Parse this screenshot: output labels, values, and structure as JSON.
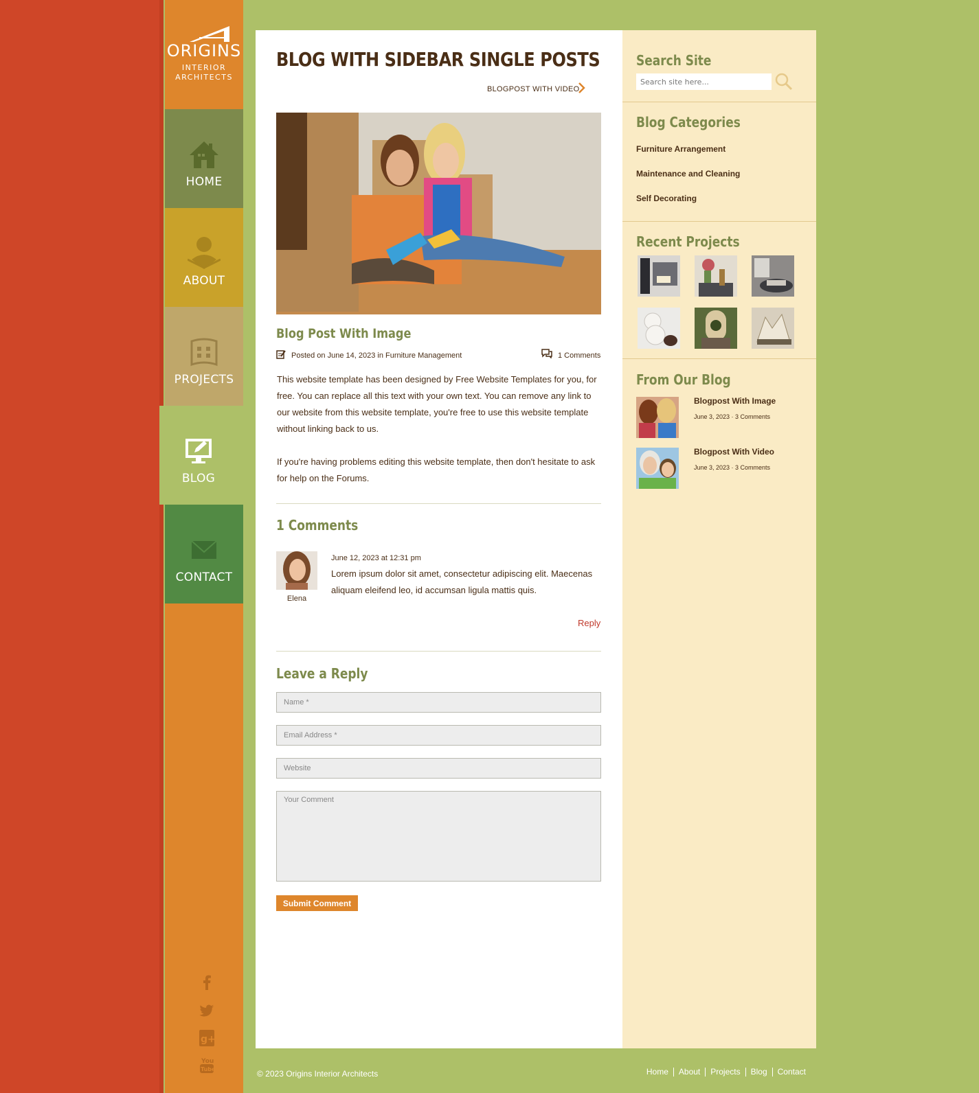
{
  "brand": {
    "name": "ORIGINS",
    "tagline_line1": "INTERIOR",
    "tagline_line2": "ARCHITECTS"
  },
  "nav": {
    "home": "HOME",
    "about": "ABOUT",
    "projects": "PROJECTS",
    "blog": "BLOG",
    "contact": "CONTACT",
    "active": "blog"
  },
  "social": [
    "facebook-icon",
    "twitter-icon",
    "google-plus-icon",
    "youtube-icon"
  ],
  "page": {
    "title": "BLOG WITH SIDEBAR SINGLE POSTS",
    "next_post_label": "BLOGPOST WITH VIDEO"
  },
  "post": {
    "title": "Blog Post With Image",
    "meta": "Posted on June 14, 2023 in Furniture Management",
    "comments_count": "1 Comments",
    "paragraph1": "This website template has been designed by Free Website Templates for you, for free. You can replace all this text with your own text. You can remove any link to our website from this website template, you're free to use this website template without linking back to us.",
    "paragraph2": "If you're having problems editing this website template, then don't hesitate to ask for help on the Forums."
  },
  "comments": {
    "heading": "1 Comments",
    "items": [
      {
        "author": "Elena",
        "date": "June 12, 2023 at 12:31 pm",
        "text": "Lorem ipsum dolor sit amet, consectetur adipiscing elit. Maecenas aliquam eleifend leo, id accumsan ligula mattis quis.",
        "reply_label": "Reply"
      }
    ]
  },
  "reply_form": {
    "heading": "Leave a Reply",
    "name_placeholder": "Name *",
    "email_placeholder": "Email Address *",
    "website_placeholder": "Website",
    "comment_placeholder": "Your Comment",
    "submit_label": "Submit Comment"
  },
  "sidebar": {
    "search_heading": "Search Site",
    "search_placeholder": "Search site here...",
    "categories_heading": "Blog Categories",
    "categories": [
      "Furniture Arrangement",
      "Maintenance and Cleaning",
      "Self Decorating"
    ],
    "projects_heading": "Recent Projects",
    "blog_heading": "From Our Blog",
    "blog_posts": [
      {
        "title": "Blogpost With Image",
        "meta": "June 3, 2023 · 3 Comments"
      },
      {
        "title": "Blogpost With Video",
        "meta": "June 3, 2023 · 3 Comments"
      }
    ]
  },
  "footer": {
    "copyright": "© 2023 Origins Interior Architects",
    "links": [
      "Home",
      "About",
      "Projects",
      "Blog",
      "Contact"
    ]
  },
  "colors": {
    "page_bg": "#adc068",
    "red_strip": "#cf4628",
    "orange_nav": "#de862c",
    "home_tile": "#7d8a4c",
    "about_tile": "#c9a22a",
    "projects_tile": "#bfa76a",
    "contact_tile": "#528a44",
    "sidebar_bg": "#faebc5",
    "heading_green": "#7d8a4c",
    "text_brown": "#4a2e16",
    "reply_red": "#c0392b"
  }
}
